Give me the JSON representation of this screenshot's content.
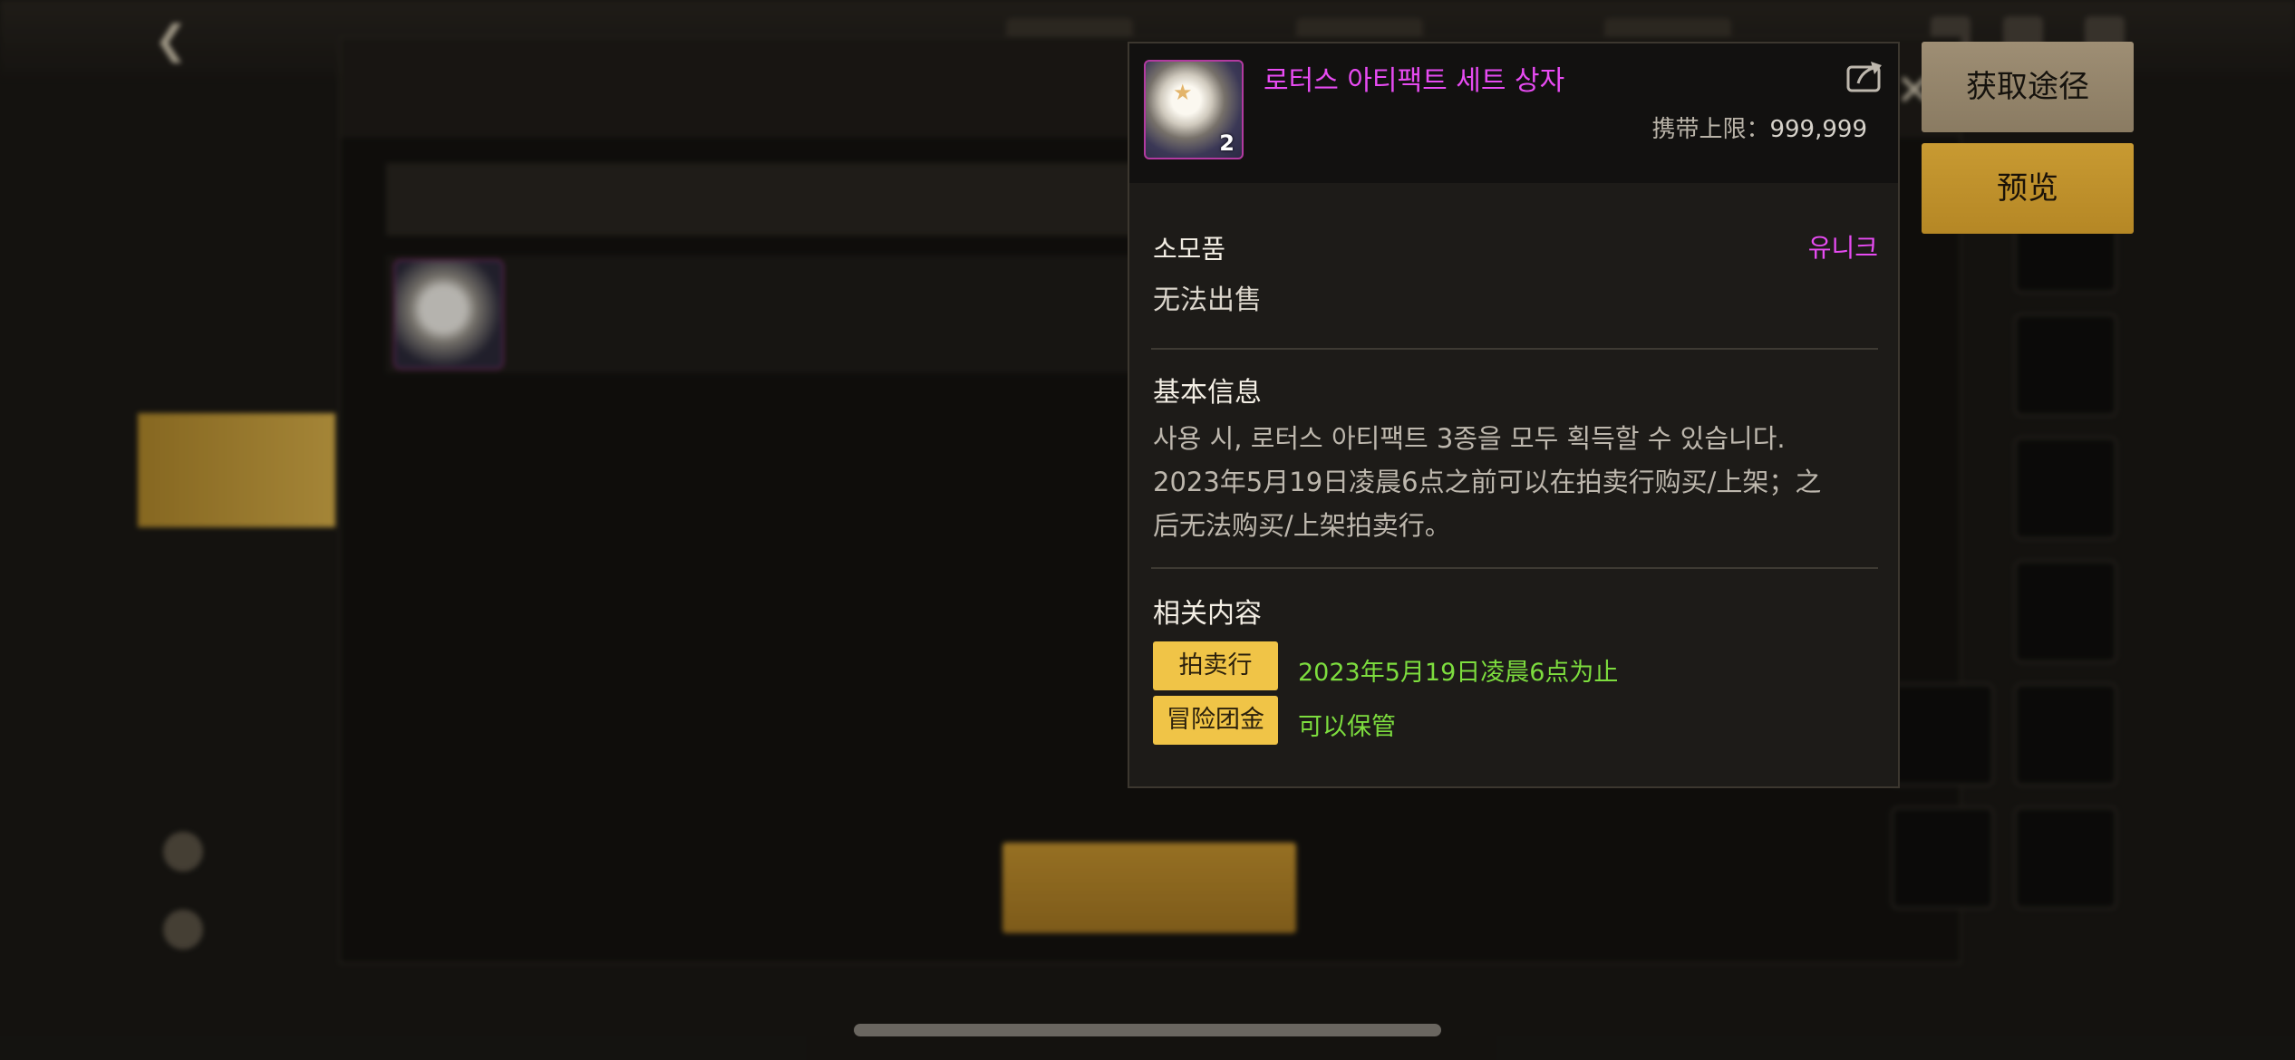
{
  "tooltip": {
    "item_name": "로터스 아티팩트 세트 상자",
    "item_count": "2",
    "carry_limit_label": "携带上限：",
    "carry_limit_value": "999,999",
    "item_type": "소모품",
    "rarity": "유니크",
    "sell_status": "无法出售",
    "basic_info_title": "基本信息",
    "description_lines": [
      "사용 시, 로터스 아티팩트 3종을 모두 획득할 수 있습니다.",
      "2023年5月19日凌晨6点之前可以在拍卖行购买/上架；之",
      "后无法购买/上架拍卖行。"
    ],
    "related_title": "相关内容",
    "related": [
      {
        "tag": "拍卖行",
        "note": "2023年5月19日凌晨6点为止"
      },
      {
        "tag": "冒险团金",
        "note": "可以保管"
      }
    ]
  },
  "actions": {
    "source_label": "获取途径",
    "preview_label": "预览"
  },
  "icons": {
    "share": "share-icon",
    "thumbnail": "item-box-icon"
  },
  "colors": {
    "item_name": "#e74bf2",
    "rarity": "#e74bf2",
    "tag_bg": "#f0c447",
    "note_green": "#7ddd3e",
    "primary_button": "#c89a32"
  }
}
